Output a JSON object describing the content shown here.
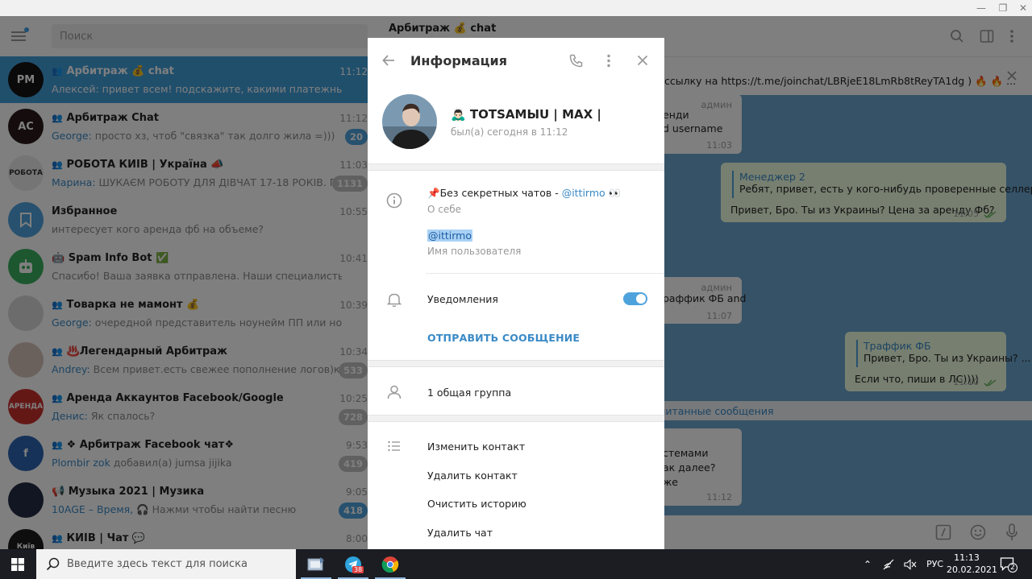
{
  "window": {
    "minimize": "—",
    "restore": "❐",
    "close": "✕"
  },
  "left": {
    "search_placeholder": "Поиск",
    "chats": [
      {
        "name": "Арбитраж 💰 chat",
        "time": "11:12",
        "sender": "",
        "message": "Алексей: привет всем! подскажите, какими платежными система...",
        "badge": "",
        "active": true,
        "group": true,
        "avatar_text": "PM",
        "avatar_color": "#141414"
      },
      {
        "name": "Арбитраж Chat",
        "time": "11:12",
        "sender": "George: ",
        "message": "просто хз, чтоб \"связка\" так долго жила =)))",
        "badge": "20",
        "badge_blue": true,
        "group": true,
        "avatar_text": "AC",
        "avatar_color": "#2a1a1a"
      },
      {
        "name": "РОБОТА КИЇВ | Україна 📣",
        "time": "11:03",
        "sender": "Марина: ",
        "message": "ШУКАЄМ РОБОТУ ДЛЯ ДІВЧАТ 17-18 РОКІВ. ПОТРІ...",
        "badge": "1131",
        "group": true,
        "avatar_text": "РОБОТА",
        "avatar_color": "#eaeaea"
      },
      {
        "name": "Избранное",
        "time": "10:55",
        "sender": "",
        "message": "интересует кого аренда фб на объеме?",
        "badge": "",
        "group": false,
        "avatar_text": "",
        "avatar_color": "#4fa3dc"
      },
      {
        "name": "🤖 Spam Info Bot ✅",
        "time": "10:41",
        "sender": "",
        "message": "Спасибо! Ваша заявка отправлена. Наши специалисты постарают...",
        "badge": "",
        "group": false,
        "avatar_text": "",
        "avatar_color": "#3aae5e"
      },
      {
        "name": "Товарка не мамонт 💰",
        "time": "10:39",
        "sender": "George: ",
        "message": "очередной представитель ноунейм ПП или норм история...",
        "badge": "",
        "group": true,
        "avatar_text": "",
        "avatar_color": "#d9d9d9"
      },
      {
        "name": "♨️Легендарный Арбитраж",
        "time": "10:34",
        "sender": "Andrey: ",
        "message": "Всем привет.есть свежее пополнение логов)кому н...",
        "badge": "533",
        "group": true,
        "avatar_text": "",
        "avatar_color": "#d7c3b8"
      },
      {
        "name": "Аренда Аккаунтов Facebook/Google",
        "time": "10:25",
        "sender": "Денис: ",
        "message": "Як спалось?",
        "badge": "728",
        "group": true,
        "avatar_text": "АРЕНДА",
        "avatar_color": "#c9302c"
      },
      {
        "name": "❖ Арбитраж Facebook чат❖",
        "time": "9:53",
        "sender": "Plombir zok ",
        "message": "добавил(а) jumsa jijika",
        "badge": "419",
        "group": true,
        "avatar_text": "f",
        "avatar_color": "#2d64b3"
      },
      {
        "name": "📢 Музыка 2021 | Музика",
        "time": "9:05",
        "sender": "10AGE – Время, ",
        "message": "🎧 Нажми чтобы найти песню",
        "badge": "418",
        "badge_blue": true,
        "group": false,
        "avatar_text": "",
        "avatar_color": "#222c44"
      },
      {
        "name": "КИЇВ | Чат 💬",
        "time": "8:00",
        "sender": "",
        "message": "",
        "badge": "",
        "group": true,
        "avatar_text": "Київ",
        "avatar_color": "#1d1d1d"
      }
    ]
  },
  "right": {
    "title": "Арбитраж 💰 chat",
    "pinned_text": "ссылку на https://t.me/joinchat/LBRjeE18LmRb8tReyTA1dg ) 🔥 🔥 ...",
    "bubble1": {
      "admin": "админ",
      "l1": "енди",
      "l2": "d username",
      "time": "11:03"
    },
    "bubble2": {
      "quote_name": "Менеджер 2",
      "quote_text": "Ребят, привет, есть у кого-нибудь проверенные селлер...",
      "text": "Привет, Бро. Ты из Украины? Цена за аренду Фб?",
      "time": "11:05"
    },
    "bubble3": {
      "admin": "админ",
      "l1": "раффик ФБ and",
      "time": "11:07"
    },
    "bubble4": {
      "quote_name": "Траффик ФБ",
      "quote_text": "Привет, Бро. Ты из Украины? ...",
      "text": "Если что, пиши в ЛС))))",
      "time": "11:10"
    },
    "unread": "читанные сообщения",
    "bubble5": {
      "l1": "стемами",
      "l2": "ак далее?",
      "l3": "же",
      "time": "11:12"
    }
  },
  "modal": {
    "title": "Информация",
    "name": "🙇🏻‍♂️ TOTSAMЫU | MAX |",
    "status": "был(а) сегодня в 11:12",
    "bio_prefix": "📌Без секретных чатов - ",
    "bio_link": "@ittirmo",
    "bio_suffix": " 👀",
    "bio_label": "О себе",
    "username": "@ittirmo",
    "username_label": "Имя пользователя",
    "notifications": "Уведомления",
    "notifications_on": true,
    "send_message": "ОТПРАВИТЬ СООБЩЕНИЕ",
    "common_groups": "1 общая группа",
    "actions": [
      "Изменить контакт",
      "Удалить контакт",
      "Очистить историю",
      "Удалить чат"
    ]
  },
  "taskbar": {
    "search_placeholder": "Введите здесь текст для поиска",
    "telegram_badge": "38",
    "lang": "РУС",
    "time": "11:13",
    "date": "20.02.2021",
    "notification_count": "2"
  }
}
